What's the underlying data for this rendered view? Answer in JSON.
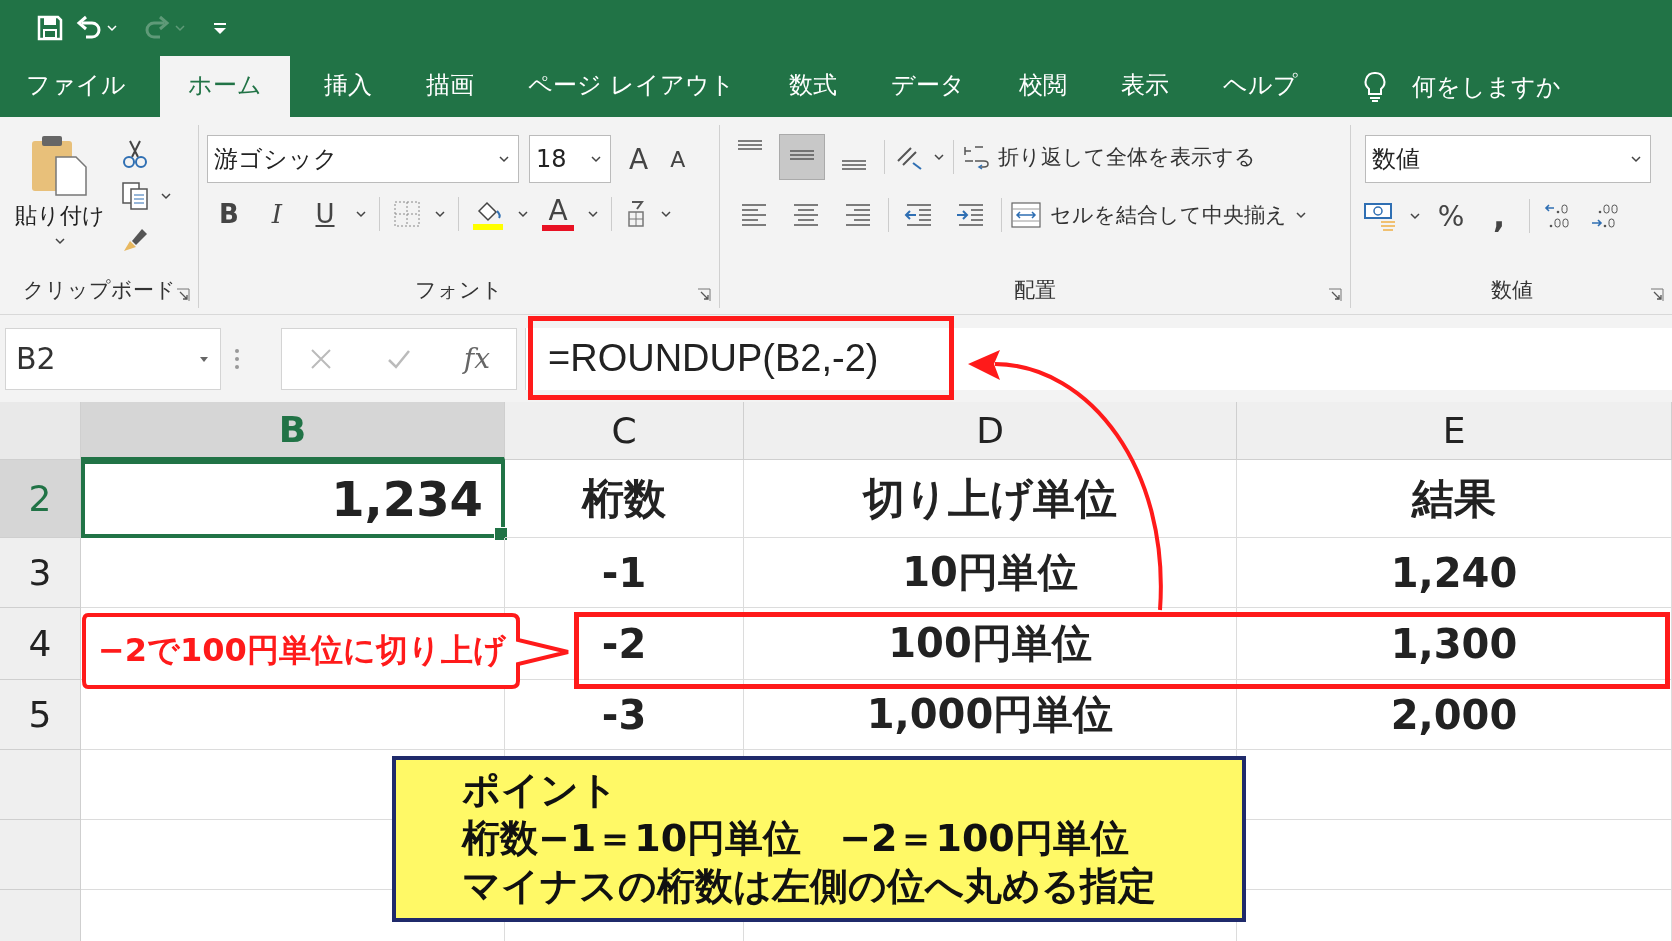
{
  "tabs": [
    {
      "label": "ファイル",
      "selected": false
    },
    {
      "label": "ホーム",
      "selected": true
    },
    {
      "label": "挿入",
      "selected": false
    },
    {
      "label": "描画",
      "selected": false
    },
    {
      "label": "ページ レイアウト",
      "selected": false
    },
    {
      "label": "数式",
      "selected": false
    },
    {
      "label": "データ",
      "selected": false
    },
    {
      "label": "校閲",
      "selected": false
    },
    {
      "label": "表示",
      "selected": false
    },
    {
      "label": "ヘルプ",
      "selected": false
    }
  ],
  "tell_me": "何をしますか",
  "ribbon": {
    "clipboard": {
      "paste": "貼り付け",
      "label": "クリップボード"
    },
    "font": {
      "font_name": "游ゴシック",
      "font_size": "18",
      "grow": "A",
      "shrink": "A",
      "styles": [
        "B",
        "I",
        "U"
      ],
      "font_color": "A",
      "label": "フォント"
    },
    "alignment": {
      "vertical": [
        {
          "selected": false
        },
        {
          "selected": true
        },
        {
          "selected": false
        }
      ],
      "wrap_text": "折り返して全体を表示する",
      "merge": "セルを結合して中央揃え",
      "label": "配置"
    },
    "number": {
      "format": "数値",
      "percent": "%",
      "comma": ",",
      "label": "数値"
    }
  },
  "formula_bar": {
    "name_box": "B2",
    "fx": "fx",
    "formula": "=ROUNDUP(B2,-2)"
  },
  "sheet": {
    "columns": [
      {
        "label": "B",
        "selected": true
      },
      {
        "label": "C",
        "selected": false
      },
      {
        "label": "D",
        "selected": false
      },
      {
        "label": "E",
        "selected": false
      }
    ],
    "rows": [
      {
        "header": "2",
        "selected": true,
        "cells": [
          "1,234",
          "桁数",
          "切り上げ単位",
          "結果"
        ]
      },
      {
        "header": "3",
        "selected": false,
        "cells": [
          "",
          "-1",
          "10円単位",
          "1,240"
        ]
      },
      {
        "header": "4",
        "selected": false,
        "cells": [
          "",
          "-2",
          "100円単位",
          "1,300"
        ]
      },
      {
        "header": "5",
        "selected": false,
        "cells": [
          "",
          "-3",
          "1,000円単位",
          "2,000"
        ]
      }
    ]
  },
  "callout": {
    "text": "−2で100円単位に切り上げ"
  },
  "note": {
    "title": "ポイント",
    "lines": [
      "桁数−1＝10円単位　−2＝100円単位",
      "マイナスの桁数は左側の位へ丸める指定"
    ]
  }
}
